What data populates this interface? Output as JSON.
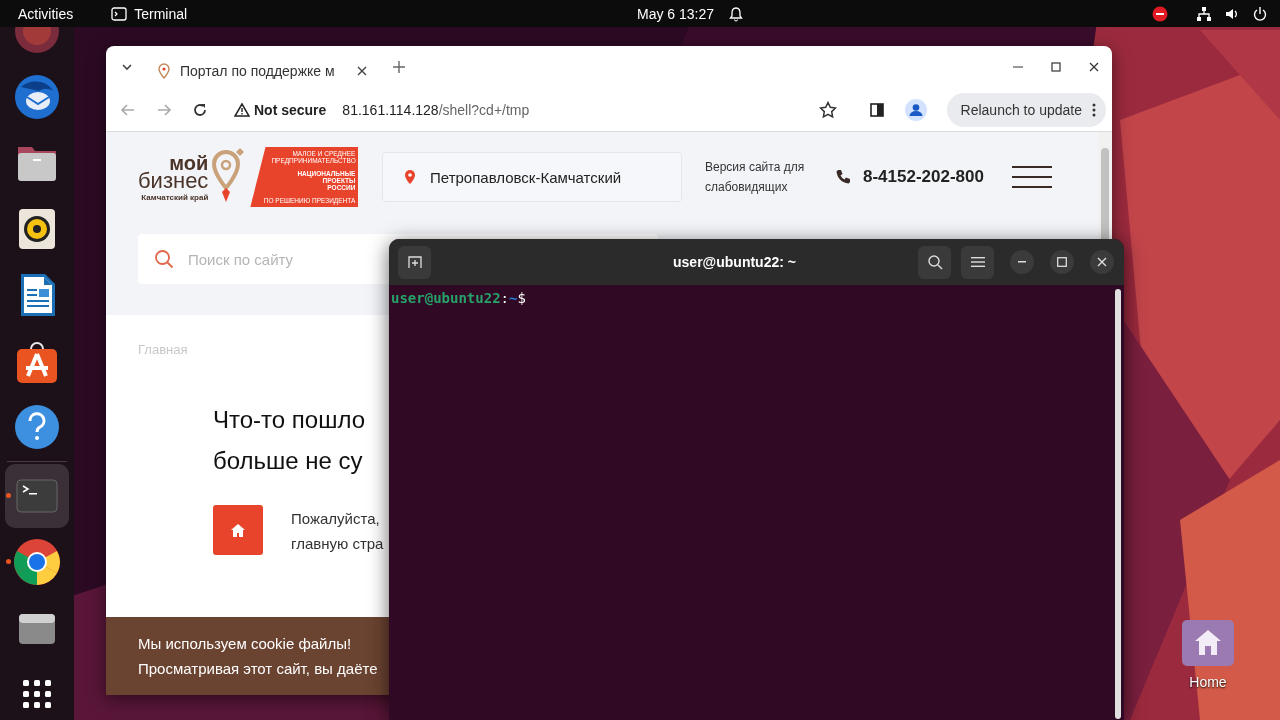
{
  "top_bar": {
    "activities": "Activities",
    "app": "Terminal",
    "clock": "May 6  13:27"
  },
  "dock": {
    "items": [
      {
        "kind": "browser",
        "running": false,
        "selected": false
      },
      {
        "kind": "mail",
        "running": false,
        "selected": false
      },
      {
        "kind": "files",
        "running": false,
        "selected": false
      },
      {
        "kind": "music",
        "running": false,
        "selected": false
      },
      {
        "kind": "writer",
        "running": false,
        "selected": false
      },
      {
        "kind": "store",
        "running": false,
        "selected": false
      },
      {
        "kind": "help",
        "running": false,
        "selected": false
      },
      {
        "kind": "separator"
      },
      {
        "kind": "terminal",
        "running": true,
        "selected": true
      },
      {
        "kind": "chrome",
        "running": true,
        "selected": false
      },
      {
        "kind": "drive",
        "running": false,
        "selected": false
      },
      {
        "kind": "grid",
        "running": false,
        "selected": false
      }
    ]
  },
  "browser": {
    "tab_title": "Портал по поддержке м",
    "security": "Not secure",
    "url_host": "81.161.114.128",
    "url_path": "/shell?cd+/tmp",
    "relaunch": "Relaunch to update"
  },
  "site": {
    "logo": {
      "line1": "мой",
      "line2": "бизнес",
      "region": "Камчатский край",
      "badge_top": "МАЛОЕ И СРЕДНЕЕ ПРЕДПРИНИМАТЕЛЬСТВО",
      "badge_mid": "НАЦИОНАЛЬНЫЕ ПРОЕКТЫ РОССИИ",
      "badge_bottom": "ПО РЕШЕНИЮ ПРЕЗИДЕНТА"
    },
    "city": "Петропавловск-Камчатский",
    "accessibility": "Версия сайта для слабовидящих",
    "phone": "8-4152-202-800",
    "search_placeholder": "Поиск по сайту",
    "breadcrumb": "Главная",
    "heading_lines": [
      "Что-то пошло",
      "больше не су"
    ],
    "message_lines": [
      "Пожалуйста,",
      "главную стра"
    ],
    "cookie_lines": [
      "Мы используем cookie файлы!",
      "Просматривая этот сайт, вы даёте"
    ]
  },
  "terminal": {
    "title": "user@ubuntu22: ~",
    "prompt_user": "user@ubuntu22",
    "prompt_sep": ":",
    "prompt_dir": "~",
    "prompt_symbol": "$"
  },
  "desktop_icons": [
    {
      "label": "Home"
    }
  ]
}
